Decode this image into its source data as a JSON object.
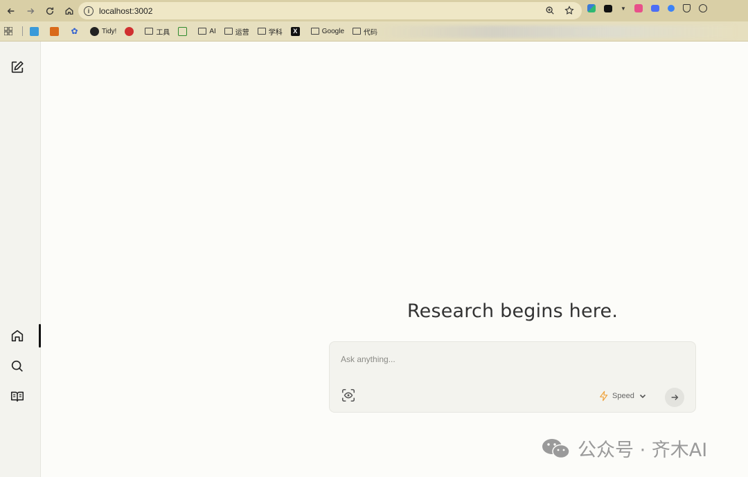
{
  "browser": {
    "url": "localhost:3002",
    "bookmarks": [
      {
        "label": "",
        "icon": "app-icon",
        "color": "#3a9ad9"
      },
      {
        "label": "",
        "icon": "fox-icon",
        "color": "#d96a1a"
      },
      {
        "label": "",
        "icon": "paw-icon",
        "color": "#2f5fd0"
      },
      {
        "label": "Tidy!",
        "icon": "globe-icon",
        "color": "#222222"
      },
      {
        "label": "",
        "icon": "badge-icon",
        "color": "#d03030"
      },
      {
        "label": "工具",
        "icon": "folder-icon",
        "color": "#444444"
      },
      {
        "label": "",
        "icon": "douban-icon",
        "color": "#2e8b2e"
      },
      {
        "label": "AI",
        "icon": "folder-icon",
        "color": "#444444"
      },
      {
        "label": "运营",
        "icon": "folder-icon",
        "color": "#444444"
      },
      {
        "label": "学科",
        "icon": "folder-icon",
        "color": "#444444"
      },
      {
        "label": "",
        "icon": "x-icon",
        "color": "#111111"
      },
      {
        "label": "Google",
        "icon": "folder-icon",
        "color": "#444444"
      },
      {
        "label": "代码",
        "icon": "folder-icon",
        "color": "#444444"
      }
    ]
  },
  "main": {
    "headline": "Research begins here.",
    "ask_placeholder": "Ask anything...",
    "speed_label": "Speed"
  },
  "watermark": {
    "text": "公众号 · 齐木AI"
  },
  "colors": {
    "accent_bolt": "#f0a33c",
    "page_bg": "#fcfcf9",
    "sidebar_bg": "#f3f3ee"
  }
}
